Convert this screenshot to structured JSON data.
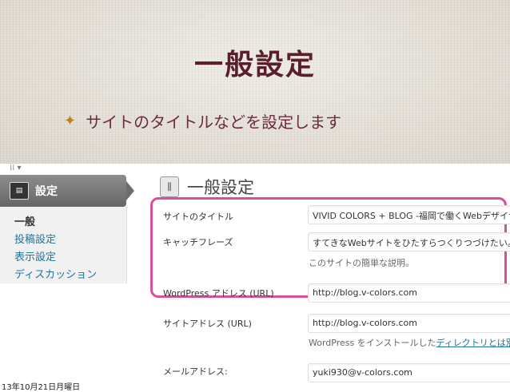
{
  "slide": {
    "title": "一般設定",
    "bullet_icon": "star-icon",
    "bullet_text": "サイトのタイトルなどを設定します",
    "dateline": "13年10月21日月曜日"
  },
  "sidebar": {
    "header_label": "設定",
    "items": [
      {
        "label": "一般",
        "current": true
      },
      {
        "label": "投稿設定",
        "current": false
      },
      {
        "label": "表示設定",
        "current": false
      },
      {
        "label": "ディスカッション",
        "current": false
      }
    ]
  },
  "main": {
    "title": "一般設定",
    "fields": [
      {
        "label": "サイトのタイトル",
        "value": "VIVID COLORS + BLOG -福岡で働くWebデザイナー"
      },
      {
        "label": "キャッチフレーズ",
        "value": "すてきなWebサイトをひたすらつくりつづけたい。",
        "desc": "このサイトの簡単な説明。"
      },
      {
        "label": "WordPress アドレス (URL)",
        "value": "http://blog.v-colors.com"
      },
      {
        "label": "サイトアドレス (URL)",
        "value": "http://blog.v-colors.com",
        "desc_prefix": "WordPress をインストールした",
        "desc_link": "ディレクトリとは別の"
      },
      {
        "label": "メールアドレス:",
        "value": "yuki930@v-colors.com"
      }
    ]
  },
  "colors": {
    "title": "#5a1f2d",
    "highlight": "#d94f9b",
    "link": "#21759b"
  }
}
